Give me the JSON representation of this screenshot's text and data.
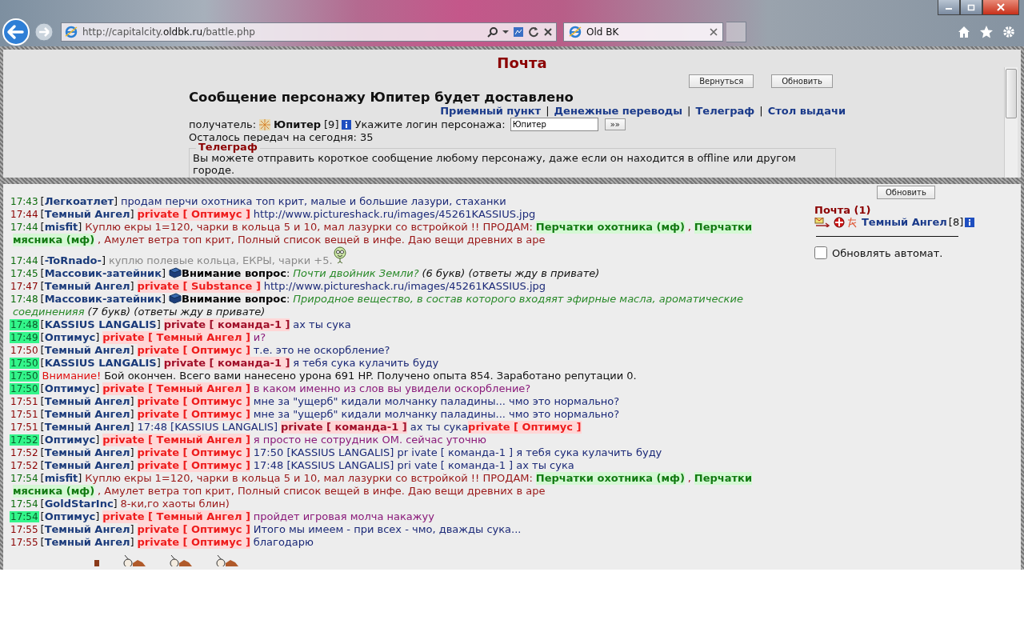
{
  "browser": {
    "url_start": "http://capitalcity.",
    "url_domain": "oldbk.ru",
    "url_end": "/battle.php",
    "tab_title": "Old BK"
  },
  "mail": {
    "title": "Почта",
    "buttons": [
      "Вернуться",
      "Обновить"
    ],
    "heading": "Сообщение персонажу Юпитер будет доставлено",
    "links": [
      "Приемный пункт",
      "Денежные переводы",
      "Телеграф",
      "Стол выдачи"
    ],
    "separators": [
      "|",
      "|",
      "|"
    ],
    "recipient_label": "получатель:",
    "recipient_name": "Юпитер",
    "recipient_level": "[9]",
    "login_label": "Укажите логин персонажа:",
    "login_value": "Юпитер",
    "go_button": "»»",
    "remaining": "Осталось передач на сегодня: 35",
    "telegraph": {
      "legend": "Телеграф",
      "text": "Вы можете отправить короткое сообщение любому персонажу, даже если он находится в offline или другом городе."
    }
  },
  "chat": {
    "messages": [
      {
        "time": "17:43",
        "kind": "public",
        "highlighted": false,
        "nick": "[**Легкоатлет**]",
        "segments": [
          {
            "kind": "text",
            "text": "продам перчи охотника топ крит, малые и большие лазури, стаханки"
          }
        ]
      },
      {
        "time": "17:44",
        "kind": "private",
        "highlighted": false,
        "nick": "[**Темный Ангел**]",
        "segments": [
          {
            "kind": "private",
            "text": "private [ Оптимус ]"
          },
          {
            "kind": "text",
            "text": "http://www.pictureshack.ru/images/45261KASSIUS.jpg"
          }
        ]
      },
      {
        "time": "17:44",
        "kind": "public",
        "highlighted": false,
        "nick": "[**misfit**]",
        "segments": [
          {
            "kind": "trade",
            "text": "Куплю екры 1=120, чарки в кольца 5 и 10, мал лазурки со встройкой !! ПРОДАМ:"
          },
          {
            "kind": "item",
            "text": "Перчатки охотника (мф)"
          },
          {
            "kind": "trade",
            "text": ","
          },
          {
            "kind": "item",
            "text": "Перчатки"
          },
          {
            "kind": "item",
            "text": "мясника (мф)"
          },
          {
            "kind": "trade",
            "text": ", Амулет ветра топ крит, Полный список вещей в инфе. Даю вещи древних в аре"
          }
        ]
      },
      {
        "time": "17:44",
        "kind": "public",
        "highlighted": false,
        "nick": "[**-ToRnado-**]",
        "segments": [
          {
            "kind": "muted",
            "text": "куплю полевые кольца, ЕКРЫ, чарки +5."
          },
          {
            "kind": "smiley"
          }
        ]
      },
      {
        "time": "17:45",
        "kind": "public",
        "highlighted": false,
        "nick": "[**Массовик-затейник**]",
        "segments": [
          {
            "kind": "book"
          },
          {
            "kind": "bold",
            "text": "Внимание вопрос"
          },
          {
            "kind": "plain",
            "text": ":",
            "attached": true
          },
          {
            "kind": "question",
            "text": "Почти двойник Земли?"
          },
          {
            "kind": "note",
            "text": "(6 букв) (ответы жду в привате)"
          }
        ]
      },
      {
        "time": "17:47",
        "kind": "private",
        "highlighted": false,
        "nick": "[**Темный Ангел**]",
        "segments": [
          {
            "kind": "private",
            "text": "private [ Substance ]"
          },
          {
            "kind": "text",
            "text": "http://www.pictureshack.ru/images/45261KASSIUS.jpg"
          }
        ]
      },
      {
        "time": "17:48",
        "kind": "public",
        "highlighted": false,
        "nick": "[**Массовик-затейник**]",
        "segments": [
          {
            "kind": "book"
          },
          {
            "kind": "bold",
            "text": "Внимание вопрос"
          },
          {
            "kind": "plain",
            "text": ":",
            "attached": true
          },
          {
            "kind": "question",
            "text": "Природное вещество, в состав которого входяят эфирные масла, ароматические"
          },
          {
            "kind": "question",
            "text": "соединенияя"
          },
          {
            "kind": "note",
            "text": "(7 букв) (ответы жду в привате)"
          }
        ]
      },
      {
        "time": "17:48",
        "kind": "private",
        "highlighted": true,
        "nick": "[**KASSIUS LANGALIS**]",
        "segments": [
          {
            "kind": "team",
            "text": "private [ команда-1 ]"
          },
          {
            "kind": "text",
            "text": "ах ты сука"
          }
        ]
      },
      {
        "time": "17:49",
        "kind": "private",
        "highlighted": true,
        "nick": "[**Оптимус**]",
        "segments": [
          {
            "kind": "private",
            "text": "private [ Темный Ангел ]"
          },
          {
            "kind": "whisper",
            "text": "и?"
          }
        ]
      },
      {
        "time": "17:50",
        "kind": "private",
        "highlighted": false,
        "nick": "[**Темный Ангел**]",
        "segments": [
          {
            "kind": "private",
            "text": "private [ Оптимус ]"
          },
          {
            "kind": "text",
            "text": "т.е. это не оскорбление?"
          }
        ]
      },
      {
        "time": "17:50",
        "kind": "private",
        "highlighted": true,
        "nick": "[**KASSIUS LANGALIS**]",
        "segments": [
          {
            "kind": "team",
            "text": "private [ команда-1 ]"
          },
          {
            "kind": "text",
            "text": "я тебя сука кулачить буду"
          }
        ]
      },
      {
        "time": "17:50",
        "kind": "private",
        "highlighted": true,
        "segments": [
          {
            "kind": "alert",
            "text": "Внимание!"
          },
          {
            "kind": "plain",
            "text": "Бой окончен. Всего вами нанесено урона 691 HP. Получено опыта 854. Заработано репутации 0."
          }
        ]
      },
      {
        "time": "17:50",
        "kind": "private",
        "highlighted": true,
        "nick": "[**Оптимус**]",
        "segments": [
          {
            "kind": "private",
            "text": "private [ Темный Ангел ]"
          },
          {
            "kind": "whisper",
            "text": "в каком именно из слов вы увидели оскорбление?"
          }
        ]
      },
      {
        "time": "17:51",
        "kind": "private",
        "highlighted": false,
        "nick": "[**Темный Ангел**]",
        "segments": [
          {
            "kind": "private",
            "text": "private [ Оптимус ]"
          },
          {
            "kind": "text",
            "text": "мне за \"ущерб\" кидали молчанку паладины... чмо это нормально?"
          }
        ]
      },
      {
        "time": "17:51",
        "kind": "private",
        "highlighted": false,
        "nick": "[**Темный Ангел**]",
        "segments": [
          {
            "kind": "private",
            "text": "private [ Оптимус ]"
          },
          {
            "kind": "text",
            "text": "мне за \"ущерб\" кидали молчанку паладины... чмо это нормально?"
          }
        ]
      },
      {
        "time": "17:51",
        "kind": "private",
        "highlighted": false,
        "nick": "[**Темный Ангел**]",
        "segments": [
          {
            "kind": "text",
            "text": "17:48 [KASSIUS LANGALIS]"
          },
          {
            "kind": "team",
            "text": "private [ команда-1 ]"
          },
          {
            "kind": "text",
            "text": "ах ты сука"
          },
          {
            "kind": "private",
            "text": "private [ Оптимус ]",
            "attached": true
          }
        ]
      },
      {
        "time": "17:52",
        "kind": "private",
        "highlighted": true,
        "nick": "[**Оптимус**]",
        "segments": [
          {
            "kind": "private",
            "text": "private [ Темный Ангел ]"
          },
          {
            "kind": "whisper",
            "text": "я просто не сотрудник ОМ. сейчас уточню"
          }
        ]
      },
      {
        "time": "17:52",
        "kind": "private",
        "highlighted": false,
        "nick": "[**Темный Ангел**]",
        "segments": [
          {
            "kind": "private",
            "text": "private [ Оптимус ]"
          },
          {
            "kind": "text",
            "text": "17:50 [KASSIUS LANGALIS] pr ivate [ команда-1 ] я тебя сука кулачить буду"
          }
        ]
      },
      {
        "time": "17:52",
        "kind": "private",
        "highlighted": false,
        "nick": "[**Темный Ангел**]",
        "segments": [
          {
            "kind": "private",
            "text": "private [ Оптимус ]"
          },
          {
            "kind": "text",
            "text": "17:48 [KASSIUS LANGALIS] pri vate [ команда-1 ] ах ты сука"
          }
        ]
      },
      {
        "time": "17:54",
        "kind": "public",
        "highlighted": false,
        "nick": "[**misfit**]",
        "segments": [
          {
            "kind": "trade",
            "text": "Куплю екры 1=120, чарки в кольца 5 и 10, мал лазурки со встройкой !! ПРОДАМ:"
          },
          {
            "kind": "item",
            "text": "Перчатки охотника (мф)"
          },
          {
            "kind": "trade",
            "text": ","
          },
          {
            "kind": "item",
            "text": "Перчатки"
          },
          {
            "kind": "item",
            "text": "мясника (мф)"
          },
          {
            "kind": "trade",
            "text": ", Амулет ветра топ крит, Полный список вещей в инфе. Даю вещи древних в аре"
          }
        ]
      },
      {
        "time": "17:54",
        "kind": "public",
        "highlighted": false,
        "nick": "[**GoldStarInc**]",
        "segments": [
          {
            "kind": "trade",
            "text": "8-ки,го хаоты блин)"
          }
        ]
      },
      {
        "time": "17:54",
        "kind": "private",
        "highlighted": true,
        "nick": "[**Оптимус**]",
        "segments": [
          {
            "kind": "private",
            "text": "private [ Темный Ангел ]"
          },
          {
            "kind": "whisper",
            "text": "пройдет игровая молча накажуу"
          }
        ]
      },
      {
        "time": "17:55",
        "kind": "private",
        "highlighted": false,
        "nick": "[**Темный Ангел**]",
        "segments": [
          {
            "kind": "private",
            "text": "private [ Оптимус ]"
          },
          {
            "kind": "text",
            "text": "Итого мы имеем - при всех - чмо, дважды сука..."
          }
        ]
      },
      {
        "time": "17:55",
        "kind": "private",
        "highlighted": false,
        "nick": "[**Темный Ангел**]",
        "segments": [
          {
            "kind": "private",
            "text": "private [ Оптимус ]"
          },
          {
            "kind": "text",
            "text": "благодарю"
          }
        ]
      }
    ]
  },
  "side": {
    "refresh_button": "Обновить",
    "mail_title": "Почта (1)",
    "sender": "Темный Ангел",
    "sender_level": "[8]",
    "auto_refresh": {
      "label": "Обновлять автомат.",
      "checked": false
    }
  }
}
